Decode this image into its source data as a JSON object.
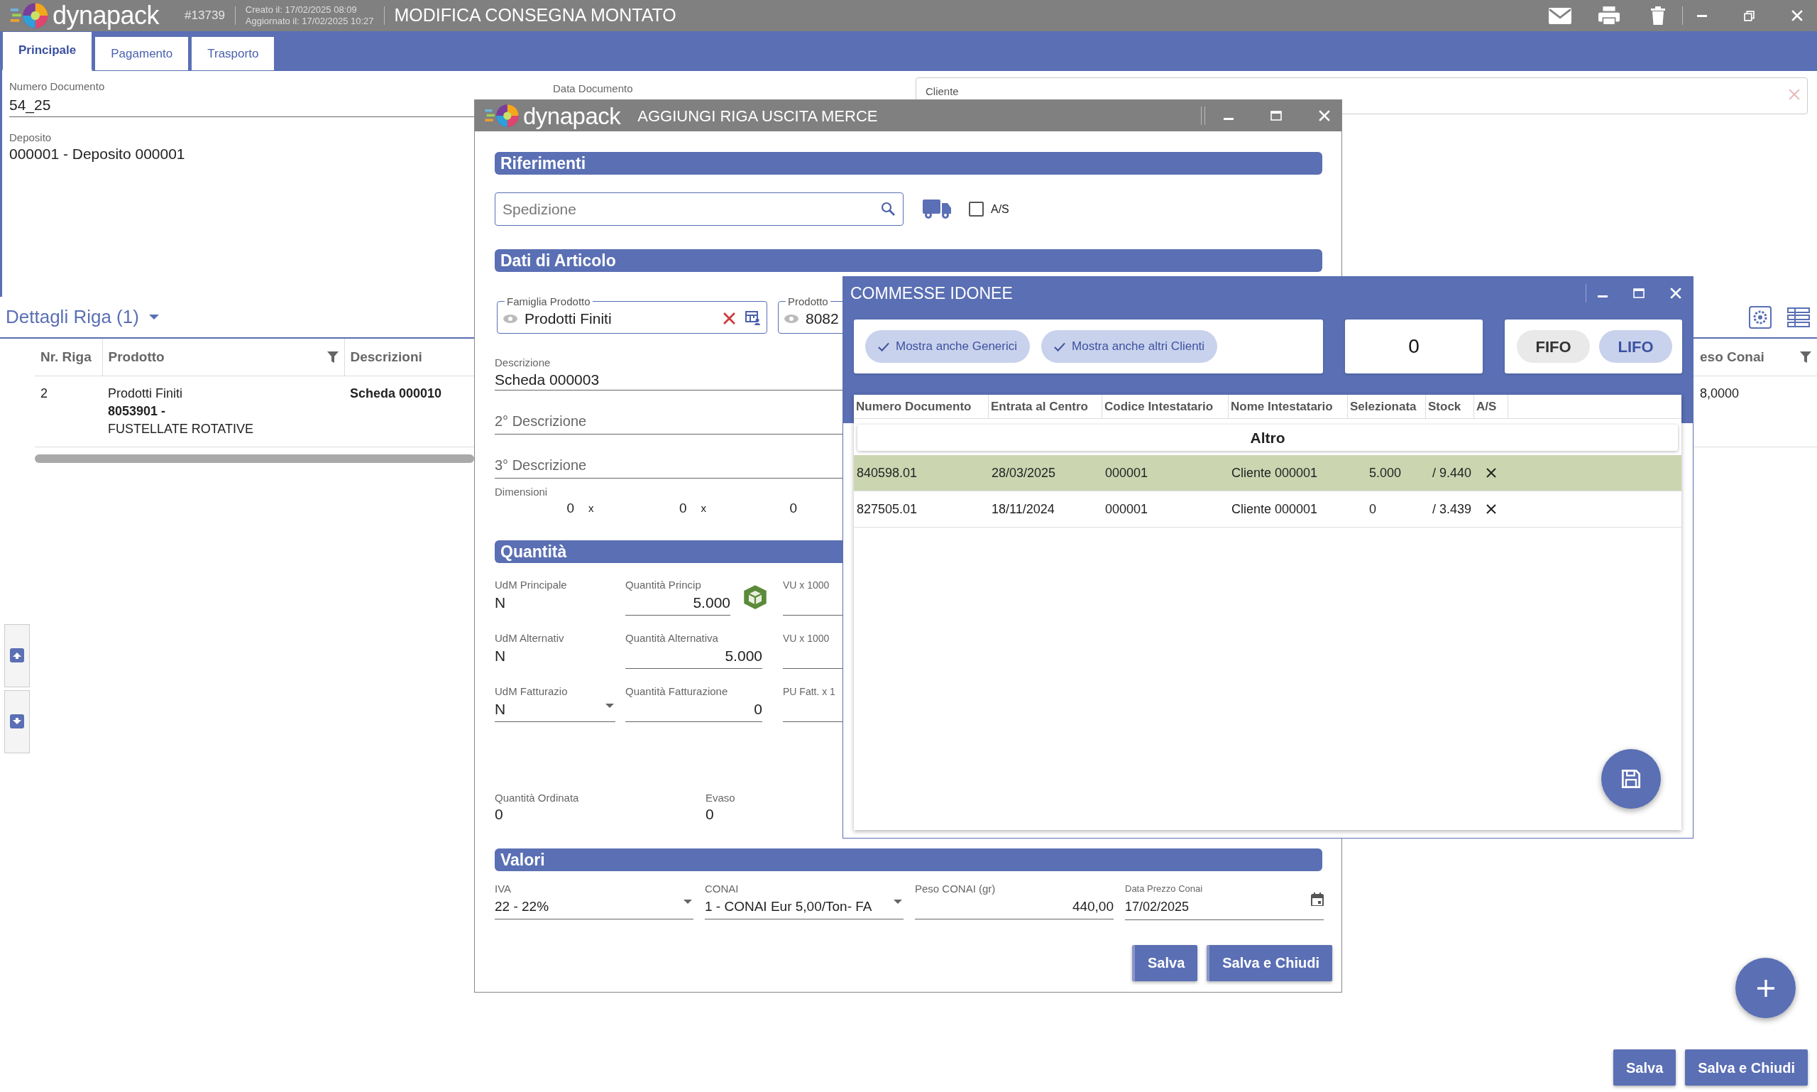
{
  "main_window": {
    "app_name": "dynapack",
    "record_number": "#13739",
    "created": "Creato il: 17/02/2025 08:09",
    "updated": "Aggiornato il: 17/02/2025 10:27",
    "title": "MODIFICA CONSEGNA MONTATO"
  },
  "tabs": [
    {
      "label": "Principale",
      "selected": true
    },
    {
      "label": "Pagamento",
      "selected": false
    },
    {
      "label": "Trasporto",
      "selected": false
    }
  ],
  "document": {
    "numero": {
      "label": "Numero Documento",
      "value": "54_25"
    },
    "data_label": "Data Documento",
    "cliente_label": "Cliente",
    "deposito": {
      "label": "Deposito",
      "value": "000001 - Deposito 000001"
    }
  },
  "details": {
    "title": "Dettagli Riga (1)",
    "columns": [
      {
        "label": "Nr. Riga",
        "filter": false
      },
      {
        "label": "Prodotto",
        "filter": true
      },
      {
        "label": "Descrizioni",
        "filter": false
      },
      {
        "label": "eso Conai",
        "filter": true
      }
    ],
    "rows": [
      {
        "number": "2",
        "product": [
          "Prodotti Finiti",
          "**8053901 -**",
          "FUSTELLATE ROTATIVE"
        ],
        "description": "Scheda 000010",
        "peso": "8,0000"
      }
    ]
  },
  "footer_buttons": [
    "Salva",
    "Salva e Chiudi"
  ],
  "add_row_dialog": {
    "app_name": "dynapack",
    "title": "AGGIUNGI RIGA USCITA MERCE",
    "riferimenti": {
      "title": "Riferimenti",
      "search_placeholder": "Spedizione",
      "as_label": "A/S",
      "as_checked": false
    },
    "articolo": {
      "title": "Dati di Articolo",
      "famiglia": {
        "label": "Famiglia Prodotto",
        "value": "Prodotti Finiti"
      },
      "prodotto": {
        "label": "Prodotto",
        "value": "8082"
      },
      "descrizione": {
        "label": "Descrizione",
        "value": "Scheda 000003"
      },
      "descrizione_2": {
        "placeholder": "2° Descrizione"
      },
      "descrizione_3": {
        "placeholder": "3° Descrizione"
      },
      "dimensioni": {
        "label": "Dimensioni",
        "values": [
          "0",
          "0",
          "0"
        ],
        "separators": [
          "x",
          "x"
        ]
      }
    },
    "quantita": {
      "title": "Quantità",
      "rows": [
        {
          "unit_label": "UdM Principale",
          "unit": "N",
          "dropdown": false,
          "qty_label": "Quantità Princip",
          "qty": "5.000",
          "box_icon": true,
          "price_label": "VU x 1000"
        },
        {
          "unit_label": "UdM Alternativ",
          "unit": "N",
          "dropdown": false,
          "qty_label": "Quantità Alternativa",
          "qty": "5.000",
          "box_icon": false,
          "price_label": "VU x 1000"
        },
        {
          "unit_label": "UdM Fatturazio",
          "unit": "N",
          "dropdown": true,
          "qty_label": "Quantità Fatturazione",
          "qty": "0",
          "box_icon": false,
          "price_label": "PU Fatt. x 1"
        }
      ],
      "ordinata": {
        "label": "Quantità Ordinata",
        "value": "0"
      },
      "evaso": {
        "label": "Evaso",
        "value": "0"
      }
    },
    "valori": {
      "title": "Valori",
      "fields": [
        {
          "kind": "select",
          "label": "IVA",
          "value": "22 - 22%"
        },
        {
          "kind": "select",
          "label": "CONAI",
          "value": "1 - CONAI Eur 5,00/Ton- FA"
        },
        {
          "kind": "number",
          "label": "Peso CONAI (gr)",
          "value": "440,00"
        },
        {
          "kind": "date",
          "label": "Data Prezzo Conai",
          "value": "17/02/2025"
        }
      ]
    },
    "buttons": [
      "Salva",
      "Salva e Chiudi"
    ]
  },
  "commesse_dialog": {
    "title": "COMMESSE IDONEE",
    "filters": [
      {
        "label": "Mostra anche Generici",
        "checked": true
      },
      {
        "label": "Mostra anche altri Clienti",
        "checked": true
      }
    ],
    "count": "0",
    "order_modes": [
      {
        "label": "FIFO",
        "selected": false
      },
      {
        "label": "LIFO",
        "selected": true
      }
    ],
    "columns": [
      "Numero Documento",
      "Entrata al Centro",
      "Codice Intestatario",
      "Nome Intestatario",
      "Selezionata",
      "Stock",
      "A/S"
    ],
    "group": "Altro",
    "rows": [
      {
        "selected": true,
        "cells": [
          "840598.01",
          "28/03/2025",
          "000001",
          "Cliente 000001",
          "5.000",
          "/ 9.440"
        ]
      },
      {
        "selected": false,
        "cells": [
          "827505.01",
          "18/11/2024",
          "000001",
          "Cliente 000001",
          "0",
          "/ 3.439"
        ]
      }
    ]
  }
}
